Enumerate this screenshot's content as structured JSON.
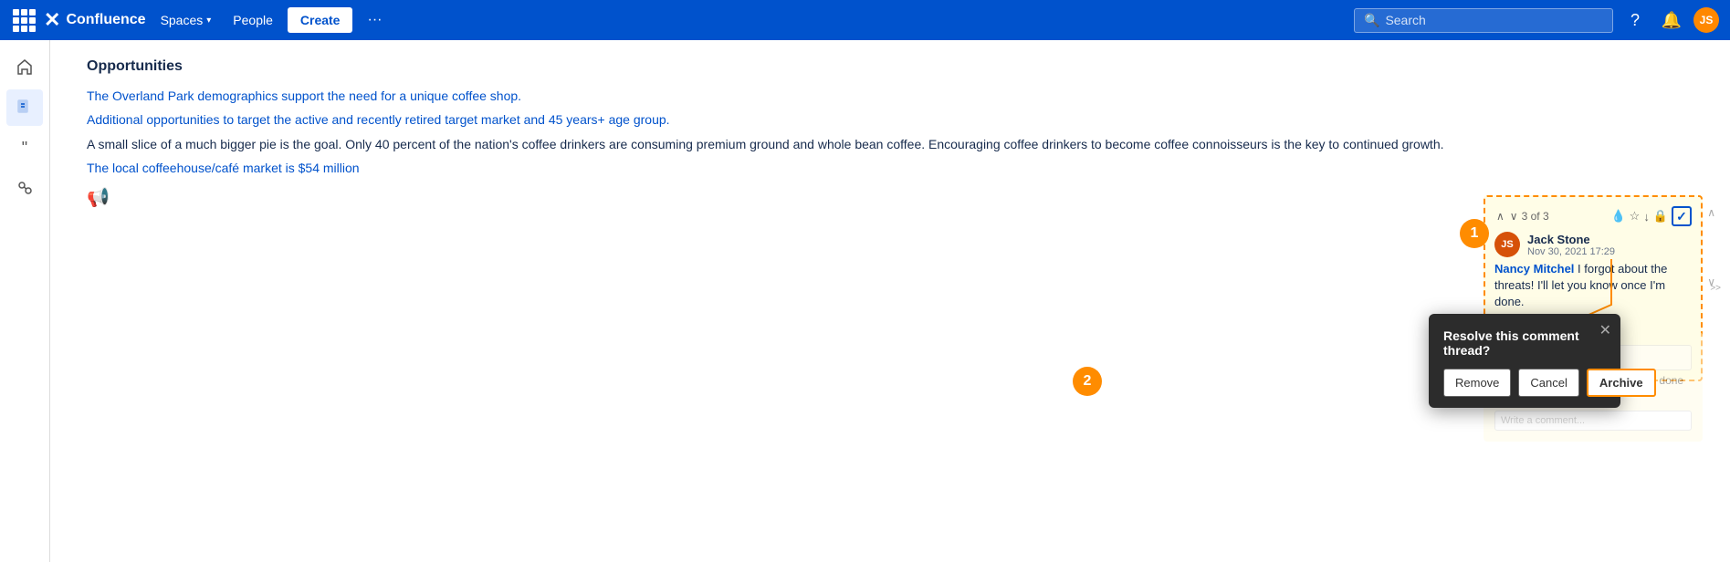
{
  "topnav": {
    "logo_text": "Confluence",
    "spaces_label": "Spaces",
    "people_label": "People",
    "create_label": "Create",
    "search_placeholder": "Search"
  },
  "sidebar": {
    "items": [
      {
        "icon": "✖",
        "name": "confluence-home"
      },
      {
        "icon": "📄",
        "name": "pages"
      },
      {
        "icon": "❝",
        "name": "drafts"
      },
      {
        "icon": "🔗",
        "name": "links"
      }
    ]
  },
  "content": {
    "section_title": "Opportunities",
    "lines": [
      "The Overland Park demographics support the need for a unique coffee shop.",
      "Additional opportunities to target the active and recently retired target market and 45 years+ age group.",
      "A small slice of a much bigger pie is the goal. Only 40 percent of the nation's coffee drinkers are consuming premium ground and whole bean coffee. Encouraging coffee drinkers to become coffee connoisseurs is the key to continued growth.",
      "The local coffeehouse/café market is $54 million"
    ]
  },
  "comment_panel": {
    "counter": "3 of 3",
    "author": "Jack Stone",
    "date": "Nov 30, 2021 17:29",
    "mention": "Nancy Mitchel",
    "body_after_mention": " I forgot about the threats! I'll let you know once I'm done.",
    "write_placeholder": "Write a comment...",
    "step_number": "1"
  },
  "resolve_dialog": {
    "title": "Resolve this comment thread?",
    "remove_label": "Remove",
    "cancel_label": "Cancel",
    "archive_label": "Archive",
    "step_number": "2",
    "bg_mention": "Nan",
    "bg_body": "ot about the thre...",
    "bg_know": "know once I'm done",
    "bg_write": "Write a comment..."
  }
}
